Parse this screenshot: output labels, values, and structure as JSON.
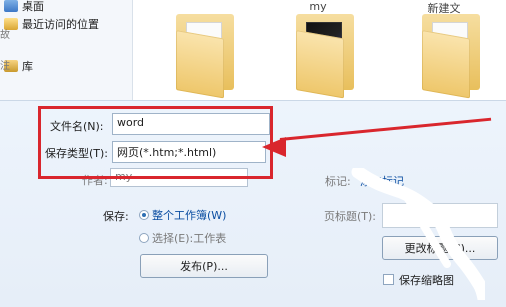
{
  "sidebar": {
    "items": [
      {
        "label": "桌面",
        "icon": "desktop-icon"
      },
      {
        "label": "最近访问的位置",
        "icon": "recent-places-icon"
      },
      {
        "label": "库",
        "icon": "library-icon"
      }
    ],
    "edge_chars": [
      "故",
      "注"
    ]
  },
  "files": {
    "items": [
      {
        "label": "",
        "icon": "folder-icon"
      },
      {
        "label": "my",
        "icon": "folder-dark-icon"
      },
      {
        "label": "新建文",
        "icon": "folder-icon"
      }
    ]
  },
  "form": {
    "filename_label": "文件名(N):",
    "filename_value": "word",
    "filetype_label": "保存类型(T):",
    "filetype_value": "网页(*.htm;*.html)",
    "author_label": "作者:",
    "author_value": "my",
    "tags_label": "标记:",
    "tags_link": "添加标记",
    "save_label": "保存:",
    "option_entire": "整个工作簿(W)",
    "option_selection": "选择(E):工作表",
    "publish_button": "发布(P)...",
    "page_title_label": "页标题(T):",
    "change_title_button": "更改标题(C)...",
    "thumbnail_label": "保存缩略图"
  },
  "colors": {
    "annotation": "#d9262d",
    "link": "#0b4ea2",
    "panel_bg": "#e6eef8"
  }
}
